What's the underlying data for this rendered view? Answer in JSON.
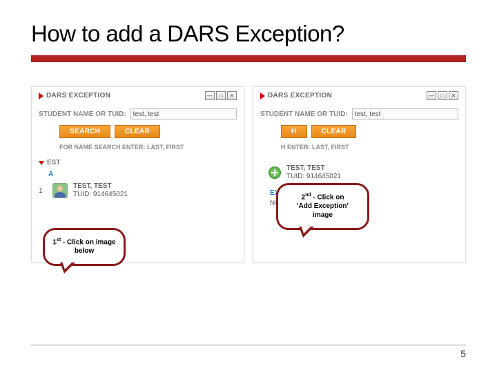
{
  "title": "How to add a DARS Exception?",
  "panels": {
    "left": {
      "heading": "DARS EXCEPTION",
      "fieldLabel": "STUDENT NAME OR TUID:",
      "fieldValue": "test, test",
      "searchBtn": "SEARCH",
      "clearBtn": "CLEAR",
      "hint": "FOR NAME SEARCH ENTER: LAST, FIRST",
      "subHeading": "EST",
      "addText": "A",
      "rowIndex": "1",
      "studentName": "TEST, TEST",
      "tuidLabel": "TUID:",
      "tuidValue": "914645021"
    },
    "right": {
      "heading": "DARS EXCEPTION",
      "fieldLabel": "STUDENT NAME OR TUID:",
      "fieldValue": "test, test",
      "searchBtn": "H",
      "clearBtn": "CLEAR",
      "hint": "H ENTER: LAST, FIRST",
      "studentName": "TEST, TEST",
      "tuidLabel": "TUID:",
      "tuidValue": "914645021",
      "exceptionHeader": "EXCEPTION(S)",
      "noException": "NO EXCEPTION"
    }
  },
  "callouts": {
    "first": {
      "ord": "1",
      "sup": "st",
      "text": " - Click on image below"
    },
    "second": {
      "ord": "2",
      "sup": "nd",
      "text1": " - Click on",
      "text2": "'Add Exception'",
      "text3": "image"
    }
  },
  "pageNumber": "5",
  "icons": {
    "minimize": "—",
    "maximize": "□",
    "close": "✕"
  }
}
